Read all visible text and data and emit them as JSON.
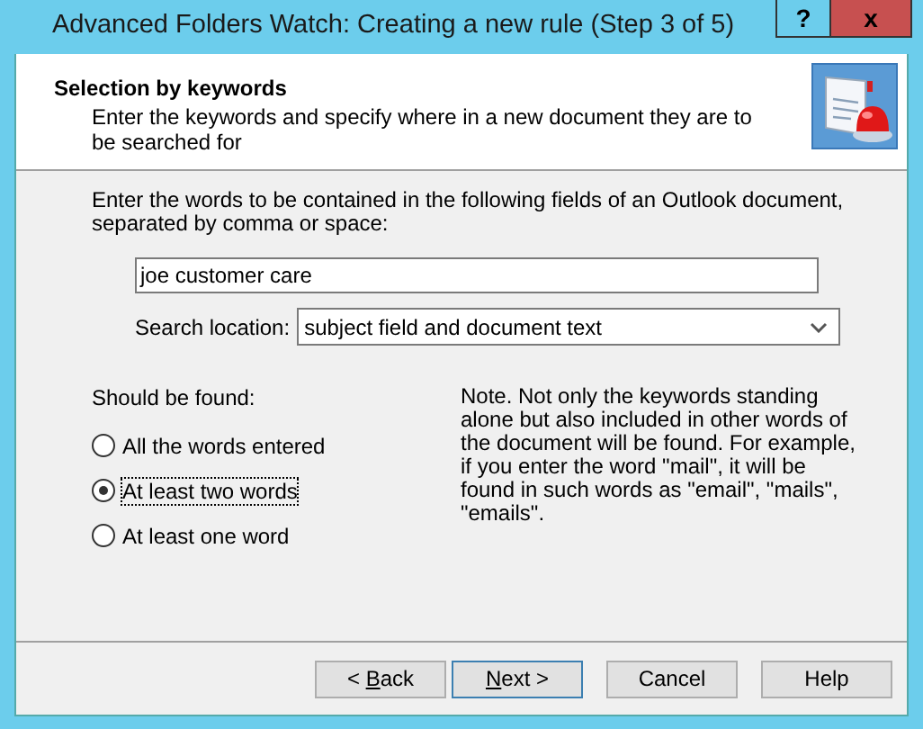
{
  "window": {
    "title": "Advanced Folders Watch: Creating a new rule (Step 3 of 5)",
    "help_button": "?",
    "close_button": "x"
  },
  "header": {
    "title": "Selection by keywords",
    "subtitle": "Enter the keywords and specify where in a new document they are to be searched for"
  },
  "instructions": "Enter the words to be contained in the following fields of an Outlook document, separated by comma or space:",
  "keywords": {
    "value": "joe customer care"
  },
  "search_location": {
    "label": "Search location:",
    "value": "subject field and document text"
  },
  "should_be_found": {
    "label": "Should be found:",
    "options": [
      {
        "label": "All the words entered",
        "selected": false
      },
      {
        "label": "At least two words",
        "selected": true
      },
      {
        "label": "At least one word",
        "selected": false
      }
    ]
  },
  "note": "Note. Not only the keywords standing alone but also included in other words of the document will be found. For example, if you enter the word \"mail\", it will be found in such words as \"email\", \"mails\", \"emails\".",
  "buttons": [
    {
      "before": "< ",
      "mnemonic": "B",
      "after": "ack",
      "default": false
    },
    {
      "mnemonic": "N",
      "after": "ext >",
      "default": true
    },
    {
      "before": "Cancel",
      "default": false
    },
    {
      "before": "Help",
      "default": false
    }
  ]
}
